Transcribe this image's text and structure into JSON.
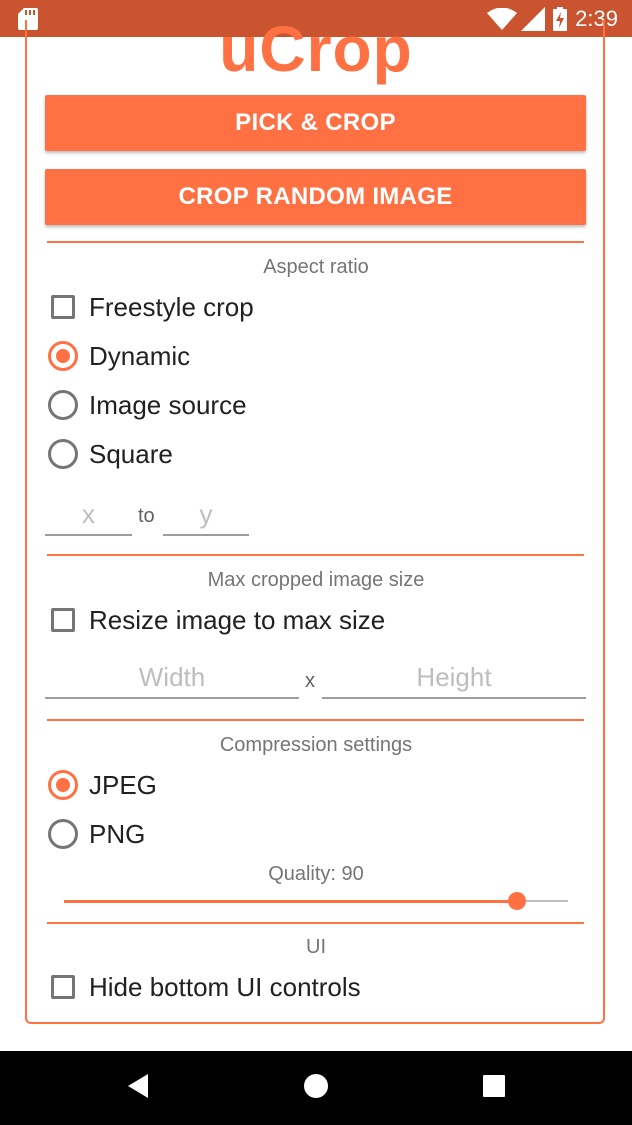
{
  "status_bar": {
    "time": "2:39"
  },
  "app": {
    "logo": "uCrop",
    "pick_crop_label": "PICK & CROP",
    "crop_random_label": "CROP RANDOM IMAGE"
  },
  "aspect_ratio": {
    "title": "Aspect ratio",
    "freestyle_label": "Freestyle crop",
    "freestyle_checked": false,
    "options": [
      {
        "label": "Dynamic",
        "selected": true
      },
      {
        "label": "Image source",
        "selected": false
      },
      {
        "label": "Square",
        "selected": false
      }
    ],
    "x_placeholder": "x",
    "to_label": "to",
    "y_placeholder": "y"
  },
  "max_size": {
    "title": "Max cropped image size",
    "resize_label": "Resize image to max size",
    "resize_checked": false,
    "width_placeholder": "Width",
    "x_label": "x",
    "height_placeholder": "Height"
  },
  "compression": {
    "title": "Compression settings",
    "options": [
      {
        "label": "JPEG",
        "selected": true
      },
      {
        "label": "PNG",
        "selected": false
      }
    ],
    "quality_label": "Quality: 90",
    "quality_value": 90
  },
  "ui_section": {
    "title": "UI",
    "hide_controls_label": "Hide bottom UI controls",
    "hide_controls_checked": false
  },
  "colors": {
    "accent": "#FF7043",
    "status_bar": "#C9542F"
  }
}
